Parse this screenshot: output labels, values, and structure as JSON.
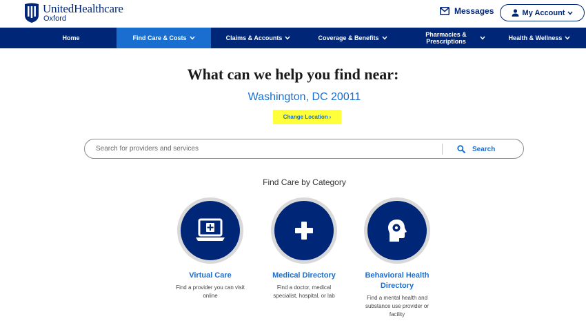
{
  "header": {
    "brand": "UnitedHealthcare",
    "sub_brand": "Oxford",
    "messages_label": "Messages",
    "account_label": "My Account"
  },
  "nav": {
    "items": [
      {
        "label": "Home"
      },
      {
        "label": "Find Care & Costs"
      },
      {
        "label": "Claims & Accounts"
      },
      {
        "label": "Coverage & Benefits"
      },
      {
        "label": "Pharmacies & Prescriptions"
      },
      {
        "label": "Health & Wellness"
      }
    ]
  },
  "main": {
    "headline": "What can we help you find near:",
    "location": "Washington, DC 20011",
    "change_location": "Change Location",
    "search": {
      "placeholder": "Search for providers and services",
      "button_label": "Search"
    },
    "category_title": "Find Care by Category",
    "categories": [
      {
        "title": "Virtual Care",
        "description": "Find a provider you can visit online",
        "icon": "laptop-medical-icon"
      },
      {
        "title": "Medical Directory",
        "description": "Find a doctor, medical specialist, hospital, or lab",
        "icon": "medical-cross-icon"
      },
      {
        "title": "Behavioral Health Directory",
        "description": "Find a mental health and substance use provider or facility",
        "icon": "head-brain-icon"
      }
    ]
  },
  "colors": {
    "primary_navy": "#002677",
    "accent_blue": "#196ecf",
    "highlight": "#ffff3a"
  }
}
